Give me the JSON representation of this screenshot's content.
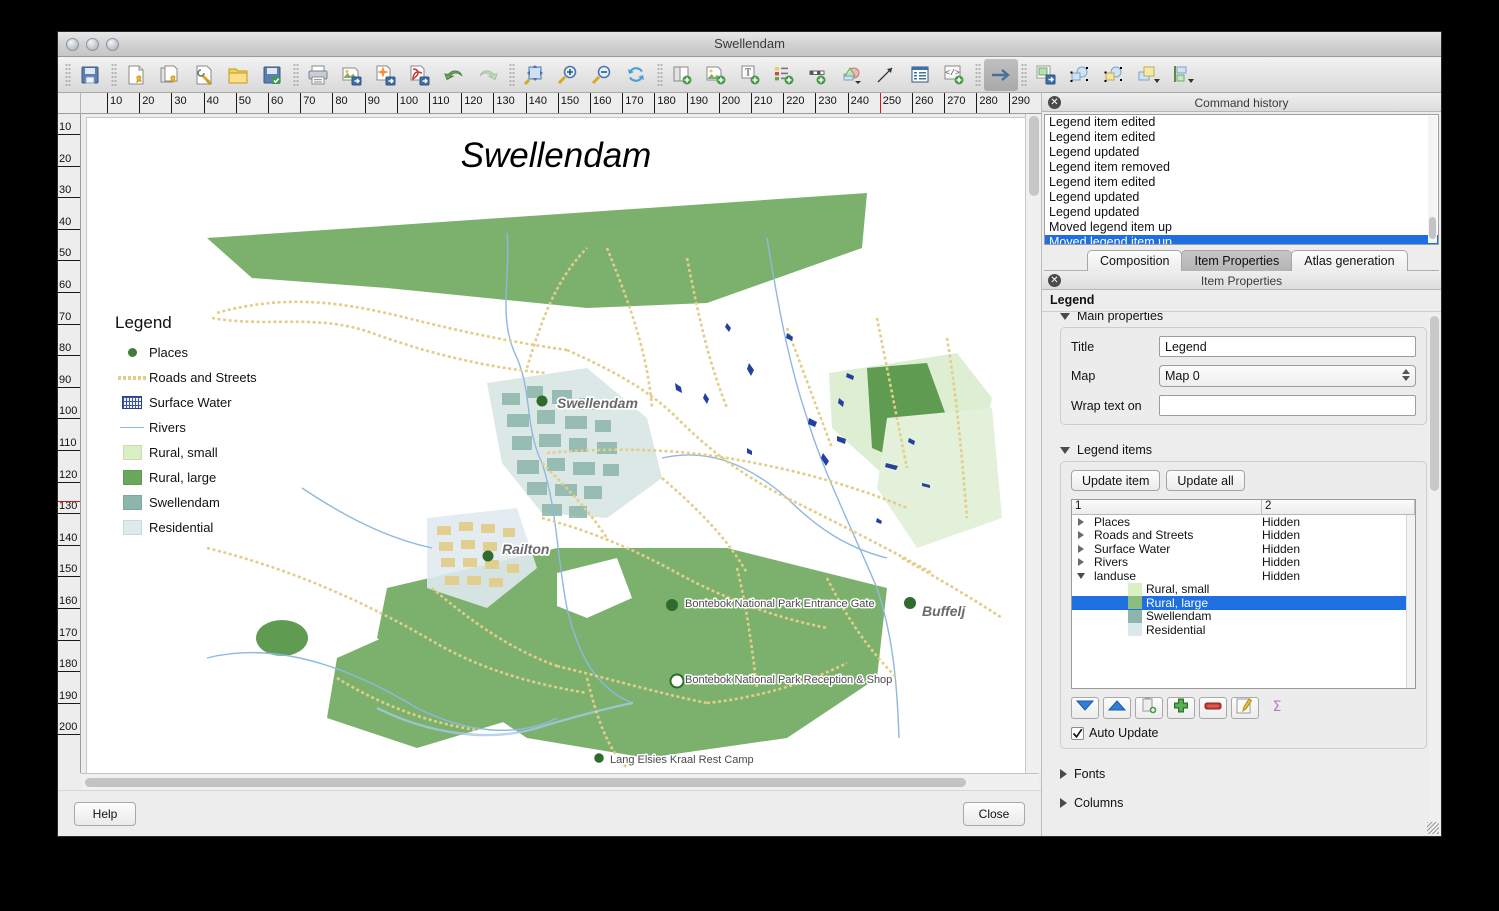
{
  "window": {
    "title": "Swellendam"
  },
  "toolbar": {
    "groups": [
      {
        "icons": [
          "save-icon"
        ]
      },
      {
        "icons": [
          "new-composer-icon",
          "duplicate-composer-icon",
          "composer-manager-icon",
          "load-template-icon",
          "save-template-icon"
        ]
      },
      {
        "icons": [
          "print-icon",
          "export-image-icon",
          "export-svg-icon",
          "export-pdf-icon",
          "undo-icon",
          "redo-icon"
        ]
      },
      {
        "icons": [
          "zoom-full-icon",
          "zoom-in-icon",
          "zoom-out-icon",
          "refresh-icon"
        ]
      },
      {
        "icons": [
          "add-map-icon",
          "add-image-icon",
          "add-label-icon",
          "add-legend-icon",
          "add-scalebar-icon",
          "add-shape-icon",
          "add-arrow-icon",
          "add-table-icon",
          "add-html-icon"
        ]
      },
      {
        "icons": [
          "select-move-item-icon"
        ]
      },
      {
        "icons": [
          "move-content-icon",
          "group-icon",
          "ungroup-icon",
          "raise-items-icon",
          "align-items-icon"
        ]
      }
    ],
    "active_icon": "select-move-item-icon"
  },
  "rulers": {
    "horizontal_labels": [
      "10",
      "20",
      "30",
      "40",
      "50",
      "60",
      "70",
      "80",
      "90",
      "100",
      "110",
      "120",
      "130",
      "140",
      "150",
      "160",
      "170",
      "180",
      "190",
      "200",
      "210",
      "220",
      "230",
      "240",
      "250",
      "260",
      "270",
      "280",
      "290"
    ],
    "vertical_labels": [
      "10",
      "20",
      "30",
      "40",
      "50",
      "60",
      "70",
      "80",
      "90",
      "100",
      "110",
      "120",
      "130",
      "140",
      "150",
      "160",
      "170",
      "180",
      "190",
      "200"
    ],
    "guide_h_at": "250",
    "guide_v_at": "125",
    "units": "mm"
  },
  "page": {
    "title": "Swellendam",
    "legend": {
      "title": "Legend",
      "items": [
        {
          "symbol": "point",
          "label": "Places",
          "color": "#3f7d3d"
        },
        {
          "symbol": "line-dashed",
          "label": "Roads and Streets",
          "color": "#e3cd8a"
        },
        {
          "symbol": "pattern-fill",
          "label": "Surface Water",
          "color": "#3a55a8"
        },
        {
          "symbol": "line",
          "label": "Rivers",
          "color": "#8fb8e0"
        },
        {
          "symbol": "fill",
          "label": "Rural, small",
          "color": "#d9f0c4"
        },
        {
          "symbol": "fill",
          "label": "Rural, large",
          "color": "#6aa85d"
        },
        {
          "symbol": "fill",
          "label": "Swellendam",
          "color": "#8cb6ab"
        },
        {
          "symbol": "fill",
          "label": "Residential",
          "color": "#dfeaef"
        }
      ]
    },
    "map_labels": [
      {
        "text": "Swellendam",
        "style": "big"
      },
      {
        "text": "Railton",
        "style": "big"
      },
      {
        "text": "Buffeljagsrivier",
        "style": "big"
      },
      {
        "text": "Bontebok National Park Entrance Gate",
        "style": "small"
      },
      {
        "text": "Bontebok National Park Reception & Shop",
        "style": "small"
      },
      {
        "text": "Lang Elsies Kraal Rest Camp",
        "style": "small"
      }
    ]
  },
  "buttons": {
    "help": "Help",
    "close": "Close"
  },
  "command_history": {
    "panel_title": "Command history",
    "entries": [
      "Legend item edited",
      "Legend item edited",
      "Legend updated",
      "Legend item removed",
      "Legend item edited",
      "Legend updated",
      "Legend updated",
      "Moved legend item up",
      "Moved legend item up"
    ],
    "selected_index": 8
  },
  "tabs": {
    "items": [
      {
        "label": "Composition",
        "selected": false
      },
      {
        "label": "Item Properties",
        "selected": true
      },
      {
        "label": "Atlas generation",
        "selected": false
      }
    ]
  },
  "item_properties": {
    "panel_title": "Item Properties",
    "item_type": "Legend",
    "main_properties": {
      "header": "Main properties",
      "title_label": "Title",
      "title_value": "Legend",
      "map_label": "Map",
      "map_value": "Map 0",
      "wrap_label": "Wrap text on",
      "wrap_value": ""
    },
    "legend_items": {
      "header": "Legend items",
      "update_item_label": "Update item",
      "update_all_label": "Update all",
      "columns": [
        "1",
        "2"
      ],
      "rows": [
        {
          "label": "Places",
          "col2": "Hidden",
          "expander": "right",
          "indent": 0,
          "swatch": null,
          "selected": false
        },
        {
          "label": "Roads and Streets",
          "col2": "Hidden",
          "expander": "right",
          "indent": 0,
          "swatch": null,
          "selected": false
        },
        {
          "label": "Surface Water",
          "col2": "Hidden",
          "expander": "right",
          "indent": 0,
          "swatch": null,
          "selected": false
        },
        {
          "label": "Rivers",
          "col2": "Hidden",
          "expander": "right",
          "indent": 0,
          "swatch": null,
          "selected": false
        },
        {
          "label": "landuse",
          "col2": "Hidden",
          "expander": "down",
          "indent": 0,
          "swatch": null,
          "selected": false
        },
        {
          "label": "Rural, small",
          "col2": "",
          "expander": null,
          "indent": 1,
          "swatch": "#d9f0c4",
          "selected": false
        },
        {
          "label": "Rural, large",
          "col2": "",
          "expander": null,
          "indent": 1,
          "swatch": "#8cbb7e",
          "selected": true
        },
        {
          "label": "Swellendam",
          "col2": "",
          "expander": null,
          "indent": 1,
          "swatch": "#8cb6ab",
          "selected": false
        },
        {
          "label": "Residential",
          "col2": "",
          "expander": null,
          "indent": 1,
          "swatch": "#dbe9ef",
          "selected": false
        }
      ],
      "toolbuttons": [
        "move-down-icon",
        "move-up-icon",
        "add-group-icon",
        "add-item-icon",
        "remove-item-icon",
        "edit-item-icon",
        "sum-icon"
      ],
      "auto_update_label": "Auto Update",
      "auto_update_checked": true
    },
    "collapsed_groups": [
      {
        "label": "Fonts"
      },
      {
        "label": "Columns"
      }
    ]
  },
  "colors": {
    "selection_blue": "#1e6fe0",
    "window_bg": "#ededed",
    "map_green_large": "#6aa85d",
    "map_green_small": "#d9f0c4",
    "map_road": "#e3cd8a",
    "map_river": "#8fb8e0",
    "map_urban": "#8cb6ab",
    "map_residential": "#dfeaef",
    "guide_red": "#e01414"
  }
}
